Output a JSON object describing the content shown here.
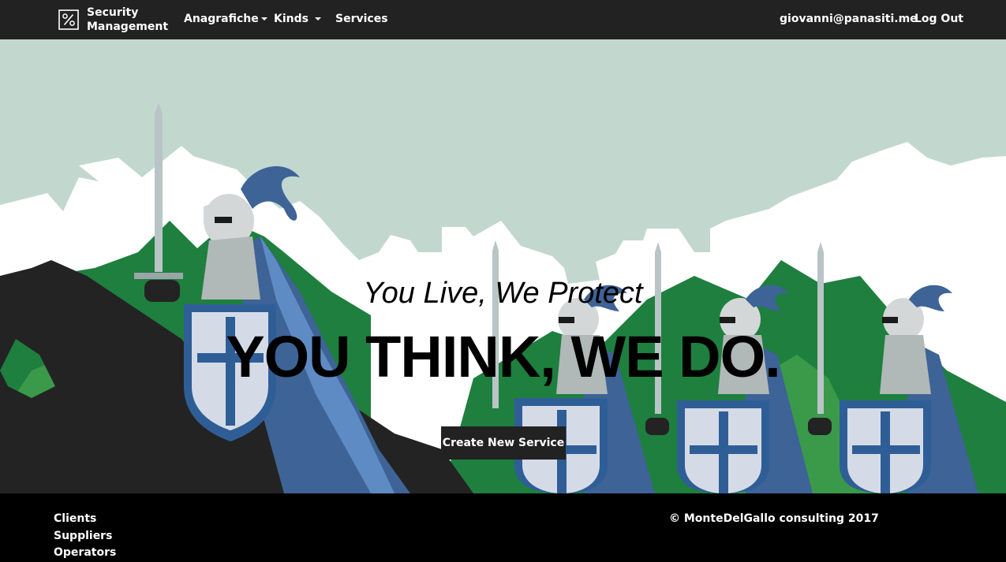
{
  "navbar": {
    "brand_line1": "Security",
    "brand_line2": "Management",
    "logo_icon": "percent-icon",
    "menu": [
      {
        "label": "Anagrafiche",
        "has_caret": true
      },
      {
        "label": "Kinds",
        "has_caret": true
      },
      {
        "label": "Services",
        "has_caret": false
      }
    ],
    "user_email": "giovanni@panasiti.me",
    "logout_label": "Log Out"
  },
  "hero": {
    "tagline": "You Live, We Protect",
    "headline": "YOU THINK, WE DO.",
    "cta_label": "Create New Service"
  },
  "footer": {
    "links": [
      "Clients",
      "Suppliers",
      "Operators"
    ],
    "copyright": "© MonteDelGallo consulting 2017"
  },
  "colors": {
    "navbar_bg": "#222222",
    "hero_sky": "#c2d8cf",
    "mountain_green": "#1e7f3e",
    "cape_blue": "#466fa3",
    "footer_bg": "#000000"
  }
}
